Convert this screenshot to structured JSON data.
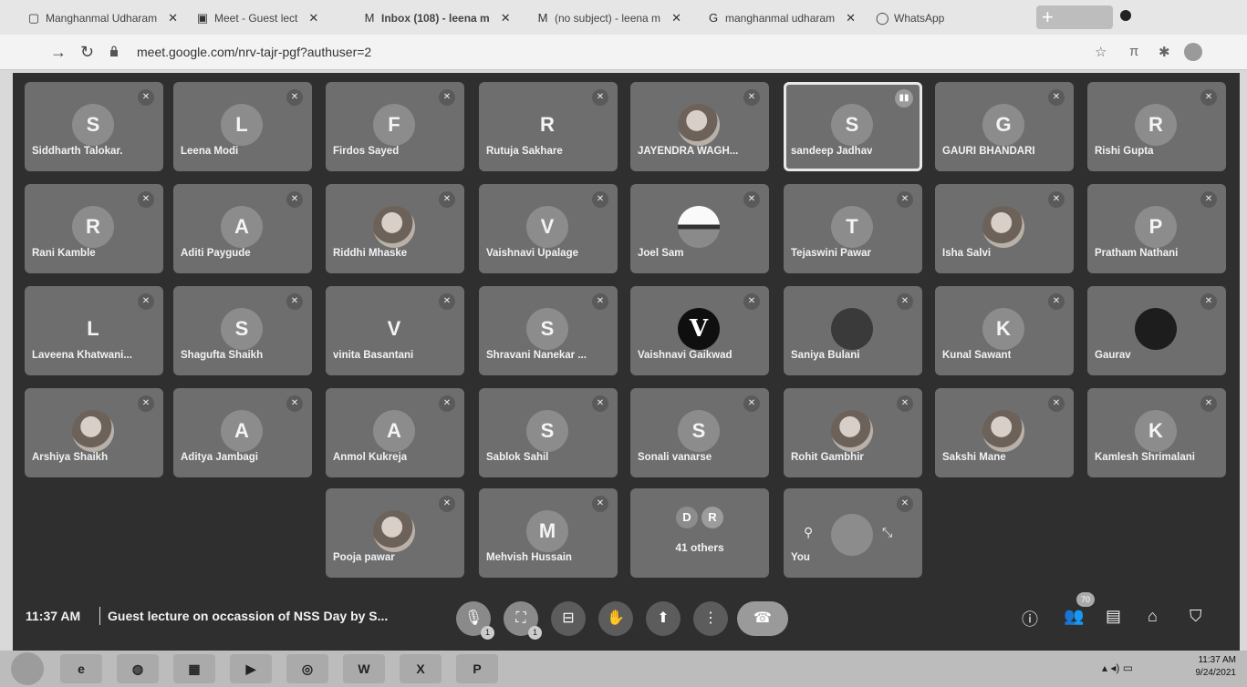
{
  "browser": {
    "tabs": [
      {
        "label": "Manghanmal Udharam",
        "icon": "page-icon",
        "bold": false
      },
      {
        "label": "Meet - Guest lect",
        "icon": "meet-icon",
        "bold": false
      },
      {
        "label": "Inbox (108) - leena m",
        "icon": "gmail-icon",
        "bold": true
      },
      {
        "label": "(no subject) - leena m",
        "icon": "gmail-icon",
        "bold": false
      },
      {
        "label": "manghanmal udharam",
        "icon": "google-icon",
        "bold": false
      },
      {
        "label": "WhatsApp",
        "icon": "whatsapp-icon",
        "bold": false
      }
    ],
    "url": "meet.google.com/nrv-tajr-pgf?authuser=2"
  },
  "tiles": [
    {
      "name": "Siddharth Talokar.",
      "initial": "S",
      "avatar": "letter",
      "state": "muted"
    },
    {
      "name": "Leena Modi",
      "initial": "L",
      "avatar": "letter",
      "state": "muted"
    },
    {
      "name": "Firdos Sayed",
      "initial": "F",
      "avatar": "letter",
      "state": "muted"
    },
    {
      "name": "Rutuja Sakhare",
      "initial": "R",
      "avatar": "plain",
      "state": "muted"
    },
    {
      "name": "JAYENDRA WAGH...",
      "initial": "",
      "avatar": "photo",
      "state": "muted"
    },
    {
      "name": "sandeep Jadhav",
      "initial": "S",
      "avatar": "letter",
      "state": "speaking"
    },
    {
      "name": "GAURI BHANDARI",
      "initial": "G",
      "avatar": "letter",
      "state": "muted"
    },
    {
      "name": "Rishi Gupta",
      "initial": "R",
      "avatar": "letter",
      "state": "muted"
    },
    {
      "name": "Rani Kamble",
      "initial": "R",
      "avatar": "letter",
      "state": "muted"
    },
    {
      "name": "Aditi Paygude",
      "initial": "A",
      "avatar": "letter",
      "state": "muted"
    },
    {
      "name": "Riddhi Mhaske",
      "initial": "",
      "avatar": "photo",
      "state": "muted"
    },
    {
      "name": "Vaishnavi Upalage",
      "initial": "V",
      "avatar": "letter",
      "state": "muted"
    },
    {
      "name": "Joel Sam",
      "initial": "",
      "avatar": "joel",
      "state": "muted"
    },
    {
      "name": "Tejaswini Pawar",
      "initial": "T",
      "avatar": "letter",
      "state": "muted"
    },
    {
      "name": "Isha Salvi",
      "initial": "",
      "avatar": "photo",
      "state": "muted"
    },
    {
      "name": "Pratham Nathani",
      "initial": "P",
      "avatar": "letter",
      "state": "muted"
    },
    {
      "name": "Laveena Khatwani...",
      "initial": "L",
      "avatar": "plain",
      "state": "muted"
    },
    {
      "name": "Shagufta Shaikh",
      "initial": "S",
      "avatar": "letter",
      "state": "muted"
    },
    {
      "name": "vinita Basantani",
      "initial": "V",
      "avatar": "plain",
      "state": "muted"
    },
    {
      "name": "Shravani Nanekar ...",
      "initial": "S",
      "avatar": "letter",
      "state": "muted"
    },
    {
      "name": "Vaishnavi Gaikwad",
      "initial": "V",
      "avatar": "vlogo",
      "state": "muted"
    },
    {
      "name": "Saniya Bulani",
      "initial": "",
      "avatar": "phone",
      "state": "muted"
    },
    {
      "name": "Kunal Sawant",
      "initial": "K",
      "avatar": "letter",
      "state": "muted"
    },
    {
      "name": "Gaurav",
      "initial": "",
      "avatar": "dark",
      "state": "muted"
    },
    {
      "name": "Arshiya Shaikh",
      "initial": "",
      "avatar": "photo",
      "state": "muted"
    },
    {
      "name": "Aditya Jambagi",
      "initial": "A",
      "avatar": "letter",
      "state": "muted"
    },
    {
      "name": "Anmol Kukreja",
      "initial": "A",
      "avatar": "letter",
      "state": "muted"
    },
    {
      "name": "Sablok Sahil",
      "initial": "S",
      "avatar": "letter",
      "state": "muted"
    },
    {
      "name": "Sonali vanarse",
      "initial": "S",
      "avatar": "letter",
      "state": "muted"
    },
    {
      "name": "Rohit Gambhir",
      "initial": "",
      "avatar": "photo",
      "state": "muted"
    },
    {
      "name": "Sakshi Mane",
      "initial": "",
      "avatar": "photo",
      "state": "muted"
    },
    {
      "name": "Kamlesh Shrimalani",
      "initial": "K",
      "avatar": "letter",
      "state": "muted"
    },
    {
      "name": "Pooja pawar",
      "initial": "",
      "avatar": "photo",
      "state": "muted"
    },
    {
      "name": "Mehvish Hussain",
      "initial": "M",
      "avatar": "letter",
      "state": "muted"
    }
  ],
  "others_tile": {
    "initials": [
      "D",
      "R"
    ],
    "label": "41 others"
  },
  "self_tile": {
    "label": "You"
  },
  "bottom": {
    "time": "11:37 AM",
    "meeting_title": "Guest lecture on occassion of NSS Day by S...",
    "participant_count": "70"
  },
  "taskbar": {
    "time": "11:37 AM",
    "date": "9/24/2021",
    "apps": [
      "ie-icon",
      "folder-icon",
      "media-icon",
      "chrome-icon",
      "word-icon",
      "excel-icon",
      "powerpoint-icon"
    ]
  }
}
